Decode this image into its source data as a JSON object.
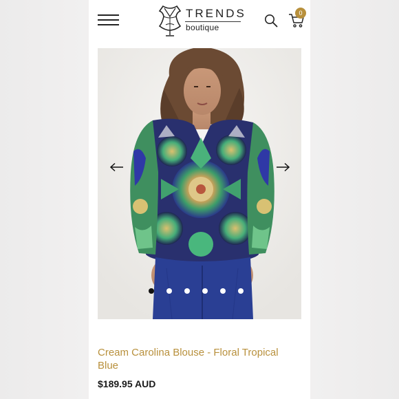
{
  "header": {
    "logo": {
      "name": "TRENDS",
      "tagline": "boutique"
    },
    "cart_count": "0",
    "icons": {
      "menu": "hamburger-menu-icon",
      "search": "search-icon",
      "cart": "cart-icon"
    }
  },
  "carousel": {
    "slide_count": 6,
    "active_slide": 0,
    "icons": {
      "prev": "arrow-left-icon",
      "next": "arrow-right-icon"
    }
  },
  "product": {
    "title": "Cream Carolina Blouse - Floral Tropical Blue",
    "price": "$189.95 AUD"
  },
  "colors": {
    "accent": "#b8903c",
    "text": "#1a1a1a",
    "background": "#ffffff",
    "page_background": "#efeeee"
  }
}
